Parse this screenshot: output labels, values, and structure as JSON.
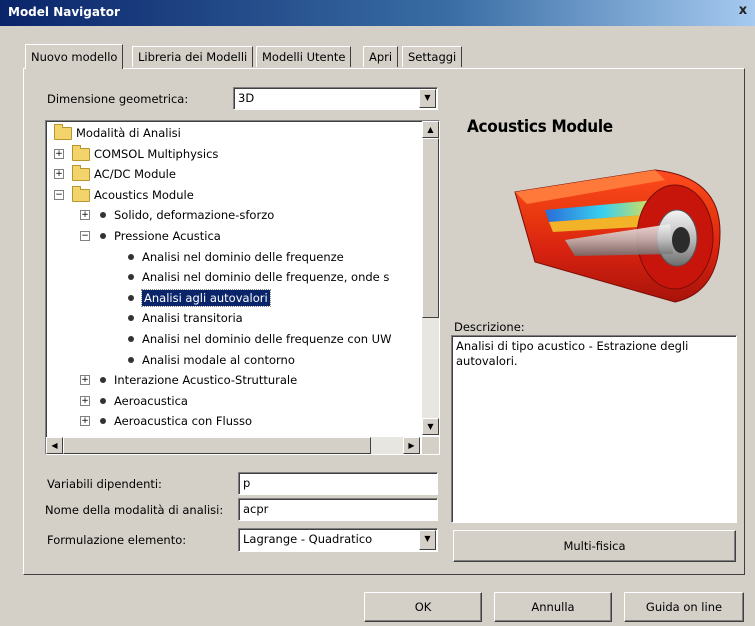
{
  "window": {
    "title": "Model Navigator",
    "close_glyph": "x"
  },
  "tabs": [
    {
      "label": "Nuovo modello",
      "active": true
    },
    {
      "label": "Libreria dei Modelli"
    },
    {
      "label": "Modelli Utente"
    },
    {
      "label": "Apri"
    },
    {
      "label": "Settaggi"
    }
  ],
  "geometry": {
    "label": "Dimensione geometrica:",
    "value": "3D"
  },
  "tree": {
    "items": [
      {
        "label": "Modalità di Analisi",
        "icon": "folder-icon"
      },
      {
        "label": "COMSOL Multiphysics",
        "icon": "folder-icon",
        "expander": "+"
      },
      {
        "label": "AC/DC Module",
        "icon": "folder-icon",
        "expander": "+"
      },
      {
        "label": "Acoustics Module",
        "icon": "folder-icon",
        "expander": "−"
      },
      {
        "label": "Solido, deformazione-sforzo",
        "icon": "bullet-icon",
        "expander": "+"
      },
      {
        "label": "Pressione Acustica",
        "icon": "bullet-icon",
        "expander": "−"
      },
      {
        "label": "Analisi nel dominio delle frequenze",
        "icon": "bullet-icon"
      },
      {
        "label": "Analisi nel dominio delle frequenze, onde s",
        "icon": "bullet-icon"
      },
      {
        "label": "Analisi agli autovalori",
        "icon": "bullet-icon",
        "selected": true
      },
      {
        "label": "Analisi transitoria",
        "icon": "bullet-icon"
      },
      {
        "label": "Analisi nel dominio delle frequenze con UW",
        "icon": "bullet-icon"
      },
      {
        "label": "Analisi modale al contorno",
        "icon": "bullet-icon"
      },
      {
        "label": "Interazione Acustico-Strutturale",
        "icon": "bullet-icon",
        "expander": "+"
      },
      {
        "label": "Aeroacustica",
        "icon": "bullet-icon",
        "expander": "+"
      },
      {
        "label": "Aeroacustica con Flusso",
        "icon": "bullet-icon",
        "expander": "+"
      }
    ]
  },
  "fields": {
    "dependent_vars_label": "Variabili dipendenti:",
    "dependent_vars_value": "p",
    "mode_name_label": "Nome della modalità di analisi:",
    "mode_name_value": "acpr",
    "element_label": "Formulazione elemento:",
    "element_value": "Lagrange - Quadratico"
  },
  "module_panel": {
    "title": "Acoustics Module",
    "description_label": "Descrizione:",
    "description_text": "Analisi di tipo acustico - Estrazione degli autovalori.",
    "multiphysics_button": "Multi-fisica"
  },
  "footer": {
    "ok": "OK",
    "cancel": "Annulla",
    "help": "Guida on line"
  },
  "colors": {
    "titlebar": "#0a246a",
    "selection": "#0a246a",
    "face": "#d4d0c8"
  }
}
